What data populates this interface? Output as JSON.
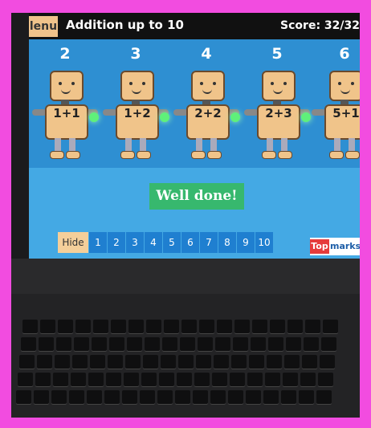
{
  "topbar": {
    "menu_label": "lenu",
    "title": "Addition up to 10",
    "score": "Score: 32/32"
  },
  "robots": [
    {
      "number": "2",
      "sum": "1+1"
    },
    {
      "number": "3",
      "sum": "1+2"
    },
    {
      "number": "4",
      "sum": "2+2"
    },
    {
      "number": "5",
      "sum": "2+3"
    },
    {
      "number": "6",
      "sum": "5+1"
    }
  ],
  "feedback": "Well done!",
  "numbar": {
    "hide_label": "Hide",
    "numbers": [
      "1",
      "2",
      "3",
      "4",
      "5",
      "6",
      "7",
      "8",
      "9",
      "10"
    ]
  },
  "brand": {
    "part1": "Top",
    "part2": "marks"
  },
  "colors": {
    "frame": "#f24ce0",
    "screen_bg": "#3aa0dc",
    "feedback_bg": "#37b86e",
    "brand_red": "#e63b3b"
  }
}
